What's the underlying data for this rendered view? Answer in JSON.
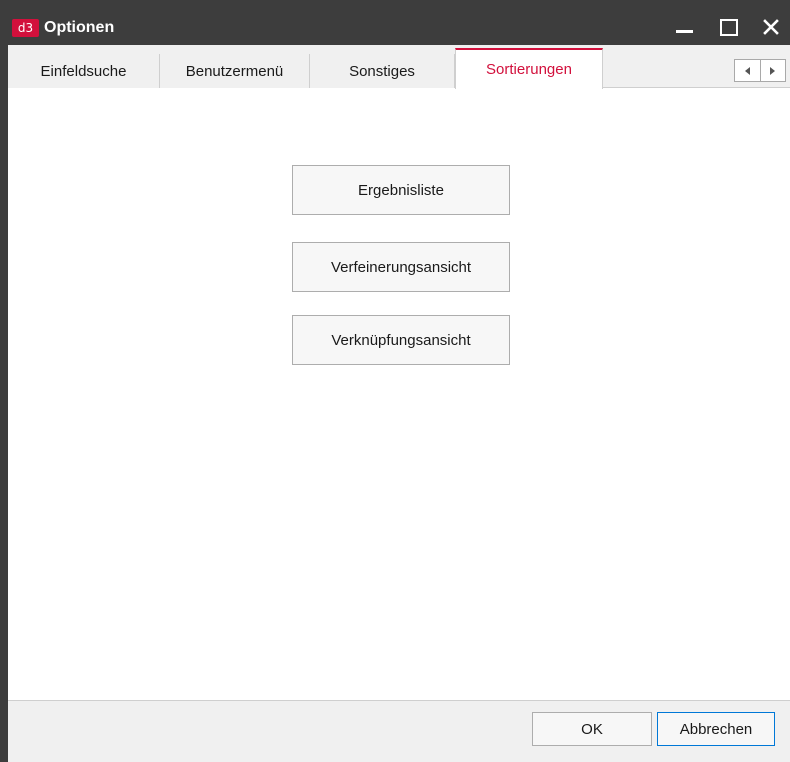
{
  "window": {
    "logo_text": "d3",
    "title": "Optionen",
    "accent_color": "#d2103c"
  },
  "tabs": [
    {
      "label": "Einfeldsuche",
      "active": false
    },
    {
      "label": "Benutzermenü",
      "active": false
    },
    {
      "label": "Sonstiges",
      "active": false
    },
    {
      "label": "Sortierungen",
      "active": true
    }
  ],
  "main": {
    "buttons": [
      {
        "label": "Ergebnisliste"
      },
      {
        "label": "Verfeinerungsansicht"
      },
      {
        "label": "Verknüpfungsansicht"
      }
    ]
  },
  "footer": {
    "ok_label": "OK",
    "cancel_label": "Abbrechen"
  }
}
